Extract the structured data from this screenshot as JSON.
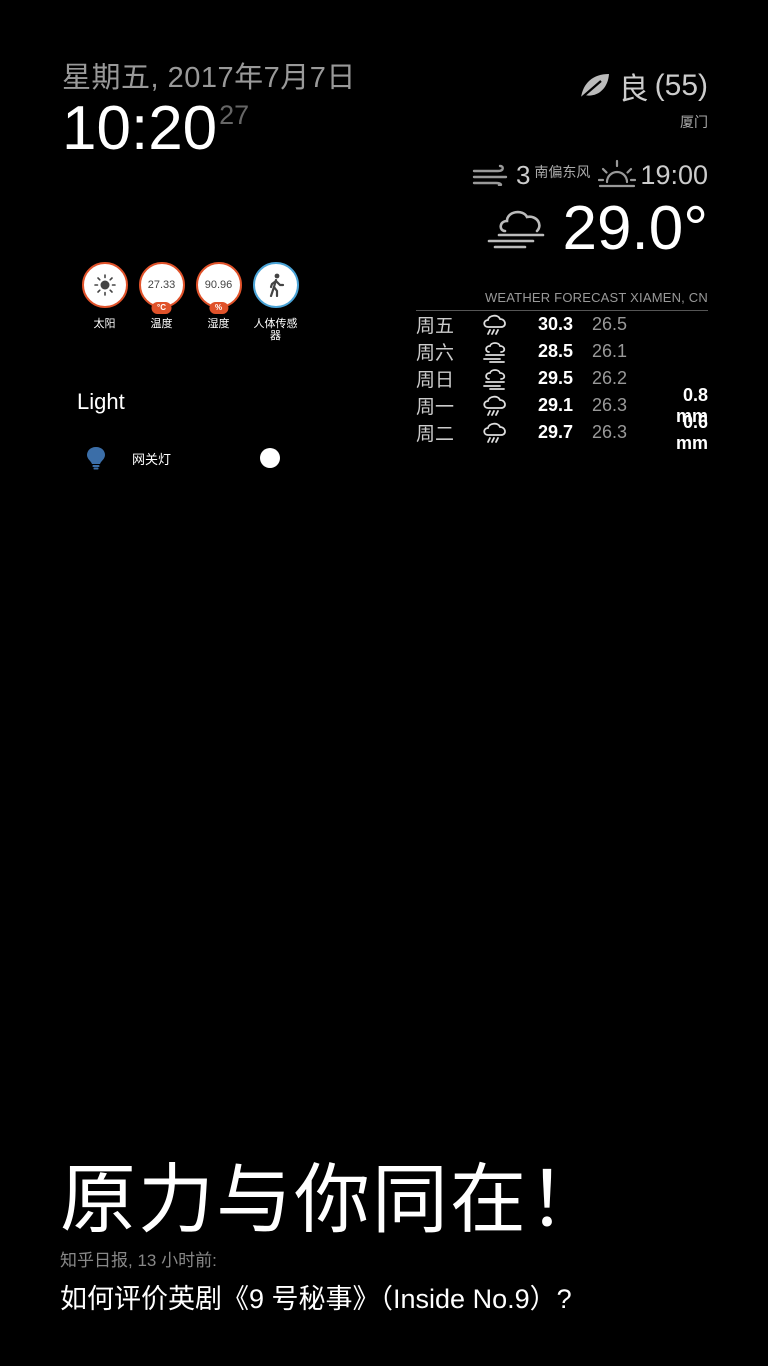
{
  "clock": {
    "date": "星期五, 2017年7月7日",
    "time": "10:20",
    "seconds": "27"
  },
  "air_quality": {
    "icon": "leaf-icon",
    "label": "良",
    "value": "(55)",
    "city": "厦门"
  },
  "current_weather": {
    "wind_icon": "wind-icon",
    "wind_speed": "3",
    "wind_direction": "南偏东风",
    "sun_icon": "sunset-icon",
    "sun_time": "19:00",
    "condition_icon": "fog-cloud-icon",
    "temperature": "29.0°"
  },
  "forecast": {
    "header": "WEATHER FORECAST XIAMEN, CN",
    "days": [
      {
        "day": "周五",
        "icon": "rain-icon",
        "max": "30.3",
        "min": "26.5",
        "rain": ""
      },
      {
        "day": "周六",
        "icon": "fog-icon",
        "max": "28.5",
        "min": "26.1",
        "rain": ""
      },
      {
        "day": "周日",
        "icon": "fog-icon",
        "max": "29.5",
        "min": "26.2",
        "rain": ""
      },
      {
        "day": "周一",
        "icon": "rain-icon",
        "max": "29.1",
        "min": "26.3",
        "rain": "0.8 mm"
      },
      {
        "day": "周二",
        "icon": "rain-icon",
        "max": "29.7",
        "min": "26.3",
        "rain": "0.6 mm"
      }
    ]
  },
  "sensors": [
    {
      "name": "太阳",
      "icon": "sun-icon",
      "value": "",
      "unit": ""
    },
    {
      "name": "温度",
      "icon": "",
      "value": "27.33",
      "unit": "°C"
    },
    {
      "name": "湿度",
      "icon": "",
      "value": "90.96",
      "unit": "%"
    },
    {
      "name": "人体传感器",
      "icon": "walking-person-icon",
      "value": "",
      "unit": ""
    }
  ],
  "light": {
    "title": "Light",
    "items": [
      {
        "name": "网关灯",
        "icon": "lightbulb-icon",
        "state": "on"
      }
    ]
  },
  "compliment": "原力与你同在！",
  "news": {
    "source": "知乎日报, 13 小时前:",
    "headline": "如何评价英剧《9 号秘事》（Inside No.9）?"
  },
  "colors": {
    "background": "#000000",
    "accent_orange": "#e0522a",
    "accent_blue": "#4aa3d6",
    "bulb_blue": "#3b6ea8"
  }
}
